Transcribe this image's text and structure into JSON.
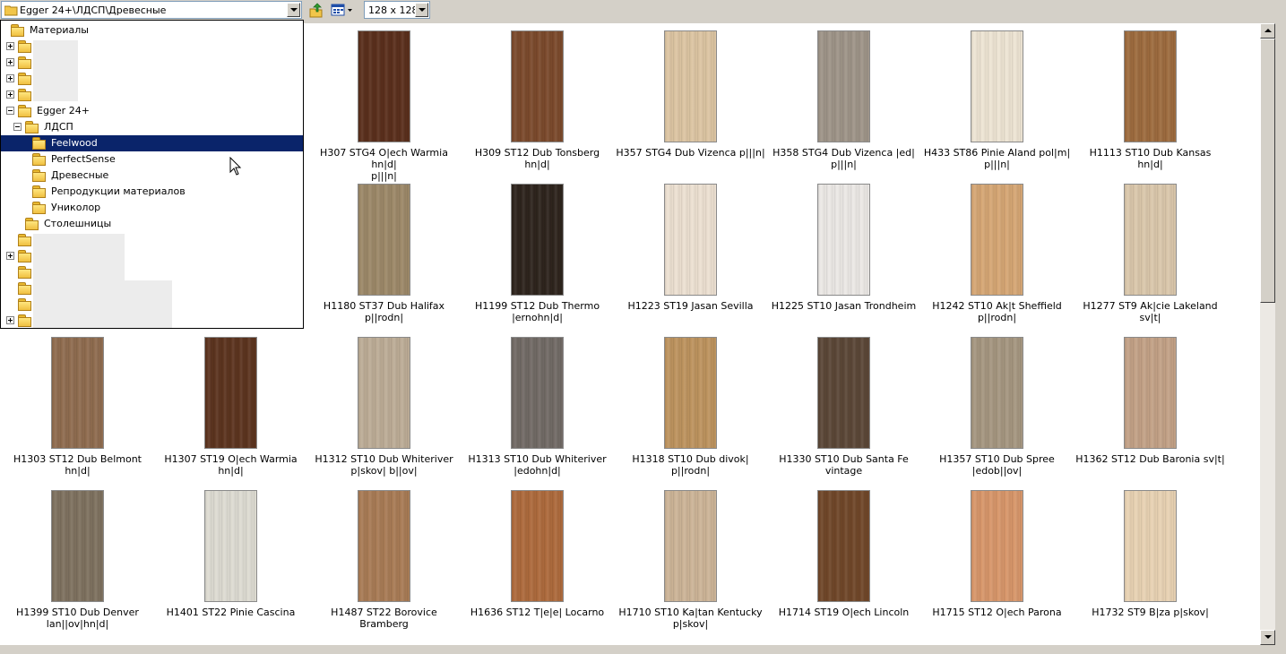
{
  "toolbar": {
    "path": "Egger 24+\\ЛДСП\\Древесные",
    "size": "128 x 128"
  },
  "tree": [
    {
      "label": "Материалы",
      "indent": 0,
      "expander": "none",
      "selected": false
    },
    {
      "label": "",
      "indent": 0,
      "expander": "plus",
      "selected": false
    },
    {
      "label": "",
      "indent": 0,
      "expander": "plus",
      "selected": false
    },
    {
      "label": "",
      "indent": 0,
      "expander": "plus",
      "selected": false
    },
    {
      "label": "",
      "indent": 0,
      "expander": "plus",
      "selected": false
    },
    {
      "label": "Egger 24+",
      "indent": 0,
      "expander": "minus",
      "selected": false
    },
    {
      "label": "ЛДСП",
      "indent": 1,
      "expander": "minus",
      "selected": false
    },
    {
      "label": "Feelwood",
      "indent": 2,
      "expander": "none",
      "selected": true
    },
    {
      "label": "PerfectSense",
      "indent": 2,
      "expander": "none",
      "selected": false
    },
    {
      "label": "Древесные",
      "indent": 2,
      "expander": "none",
      "selected": false
    },
    {
      "label": "Репродукции материалов",
      "indent": 2,
      "expander": "none",
      "selected": false
    },
    {
      "label": "Униколор",
      "indent": 2,
      "expander": "none",
      "selected": false
    },
    {
      "label": "Столешницы",
      "indent": 1,
      "expander": "none",
      "selected": false
    },
    {
      "label": "",
      "indent": 0,
      "expander": "none",
      "selected": false
    },
    {
      "label": "",
      "indent": 0,
      "expander": "plus",
      "selected": false
    },
    {
      "label": "",
      "indent": 0,
      "expander": "none",
      "selected": false
    },
    {
      "label": "",
      "indent": 0,
      "expander": "none",
      "selected": false
    },
    {
      "label": "",
      "indent": 0,
      "expander": "none",
      "selected": false
    },
    {
      "label": "",
      "indent": 0,
      "expander": "plus",
      "selected": false
    }
  ],
  "materials": [
    {
      "label": "",
      "color": "#ffffff"
    },
    {
      "label": "",
      "color": "#ffffff"
    },
    {
      "label": "H307 STG4 O|ech Warmia hn|d|\np|||n|",
      "color": "#5a2f1c"
    },
    {
      "label": "H309 ST12 Dub Tonsberg hn|d|",
      "color": "#7b4a2c"
    },
    {
      "label": "H357 STG4 Dub Vizenca p|||n|",
      "color": "#dcc4a2"
    },
    {
      "label": "H358 STG4 Dub Vizenca |ed|\np|||n|",
      "color": "#9e9488"
    },
    {
      "label": "H433 ST86 Pinie Aland pol|m|\np|||n|",
      "color": "#ede4d3"
    },
    {
      "label": "H1113 ST10 Dub Kansas hn|d|",
      "color": "#9d6b3e"
    },
    {
      "label": "",
      "color": "#ffffff"
    },
    {
      "label": "",
      "color": "#ffffff"
    },
    {
      "label": "H1180 ST37 Dub Halifax p||rodn|",
      "color": "#9c8868"
    },
    {
      "label": "H1199 ST12 Dub Thermo\n|ernohn|d|",
      "color": "#2e241d"
    },
    {
      "label": "H1223 ST19 Jasan Sevilla",
      "color": "#ece0d1"
    },
    {
      "label": "H1225 ST10 Jasan Trondheim",
      "color": "#ebe8e5"
    },
    {
      "label": "H1242 ST10 Ak|t Sheffield p||rodn|",
      "color": "#d5a674"
    },
    {
      "label": "H1277 ST9 Ak|cie Lakeland sv|t|",
      "color": "#dac7ab"
    },
    {
      "label": "H1303 ST12 Dub Belmont hn|d|",
      "color": "#8f6c4f"
    },
    {
      "label": "H1307 ST19 O|ech Warmia hn|d|",
      "color": "#5c341f"
    },
    {
      "label": "H1312 ST10 Dub Whiteriver\np|skov| b||ov|",
      "color": "#bcac96"
    },
    {
      "label": "H1313 ST10 Dub Whiteriver\n|edohn|d|",
      "color": "#716a65"
    },
    {
      "label": "H1318 ST10  Dub divok| p||rodn|",
      "color": "#bd935e"
    },
    {
      "label": "H1330 ST10 Dub Santa Fe\nvintage",
      "color": "#5b4737"
    },
    {
      "label": "H1357 ST10 Dub Spree |edob||ov|",
      "color": "#a59680"
    },
    {
      "label": "H1362 ST12 Dub Baronia sv|t|",
      "color": "#c2a186"
    },
    {
      "label": "H1399 ST10 Dub Denver\nlan||ov|hn|d|",
      "color": "#7e715f"
    },
    {
      "label": "H1401 ST22 Pinie Cascina",
      "color": "#dddbd2"
    },
    {
      "label": "H1487 ST22 Borovice Bramberg",
      "color": "#a87b55"
    },
    {
      "label": "H1636 ST12 T|e|e| Locarno",
      "color": "#ad6a3c"
    },
    {
      "label": "H1710 ST10 Ka|tan Kentucky\np|skov|",
      "color": "#ccb497"
    },
    {
      "label": "H1714 ST19 O|ech Lincoln",
      "color": "#704729"
    },
    {
      "label": "H1715 ST12 O|ech Parona",
      "color": "#d7966a"
    },
    {
      "label": "H1732 ST9 B|za p|skov|",
      "color": "#e8d2b3"
    }
  ]
}
